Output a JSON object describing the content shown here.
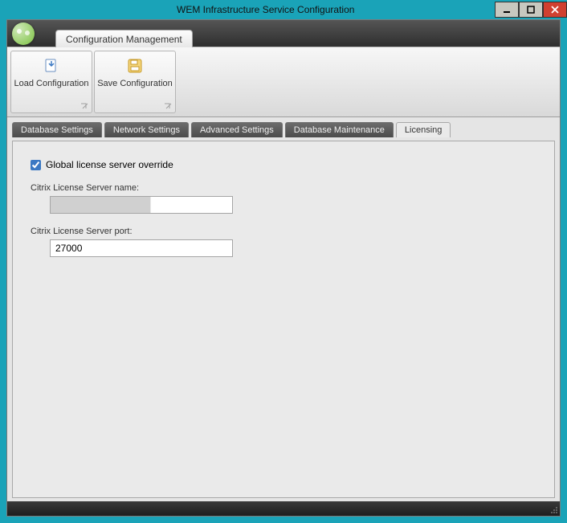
{
  "window": {
    "title": "WEM Infrastructure Service Configuration"
  },
  "ribbon": {
    "tab_label": "Configuration Management",
    "load_config_label": "Load Configuration",
    "save_config_label": "Save Configuration"
  },
  "tabs": [
    {
      "label": "Database Settings"
    },
    {
      "label": "Network Settings"
    },
    {
      "label": "Advanced Settings"
    },
    {
      "label": "Database Maintenance"
    },
    {
      "label": "Licensing"
    }
  ],
  "licensing": {
    "override_label": "Global license server override",
    "override_checked": true,
    "server_name_label": "Citrix License Server name:",
    "server_name_value": "",
    "server_port_label": "Citrix License Server port:",
    "server_port_value": "27000"
  }
}
